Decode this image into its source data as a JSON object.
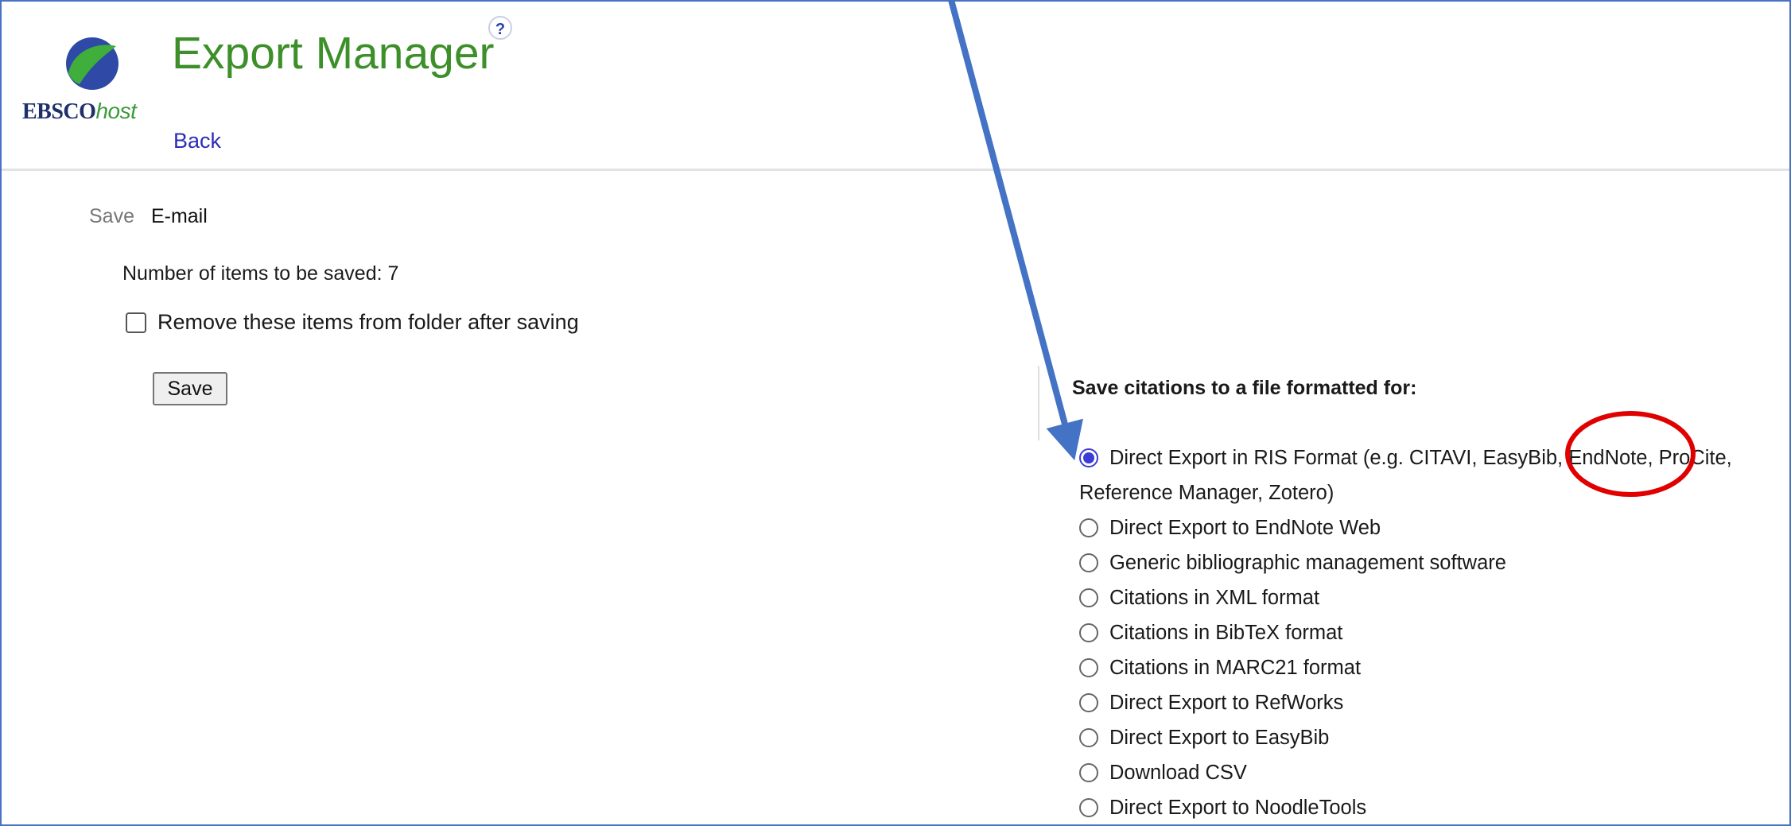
{
  "header": {
    "logo_text_bold": "EBSCO",
    "logo_text_italic": "host",
    "title": "Export Manager",
    "help_glyph": "?",
    "back_label": "Back"
  },
  "tabs": {
    "save": "Save",
    "email": "E-mail"
  },
  "save_panel": {
    "count_text": "Number of items to be saved: 7",
    "remove_checkbox_label": "Remove these items from folder after saving",
    "remove_checked": false,
    "save_button": "Save"
  },
  "format_panel": {
    "heading": "Save citations to a file formatted for:",
    "options": [
      {
        "label": "Direct Export in RIS Format (e.g. CITAVI, EasyBib, EndNote, ProCite, Reference Manager, Zotero)",
        "selected": true
      },
      {
        "label": "Direct Export to EndNote Web",
        "selected": false
      },
      {
        "label": "Generic bibliographic management software",
        "selected": false
      },
      {
        "label": "Citations in XML format",
        "selected": false
      },
      {
        "label": "Citations in BibTeX format",
        "selected": false
      },
      {
        "label": "Citations in MARC21 format",
        "selected": false
      },
      {
        "label": "Direct Export to RefWorks",
        "selected": false
      },
      {
        "label": "Direct Export to EasyBib",
        "selected": false
      },
      {
        "label": "Download CSV",
        "selected": false
      },
      {
        "label": "Direct Export to NoodleTools",
        "selected": false
      }
    ]
  },
  "colors": {
    "title_green": "#3d8f2a",
    "link_blue": "#2d2db8",
    "radio_selected": "#3b3bd6",
    "annotation_arrow": "#4472c4",
    "annotation_circle": "#e00000",
    "frame_border": "#4a72c4"
  },
  "icons": {
    "logo": "ebsco-leaf-logo",
    "help": "help-circle-icon",
    "arrow": "annotation-arrow",
    "circle": "annotation-circle"
  }
}
